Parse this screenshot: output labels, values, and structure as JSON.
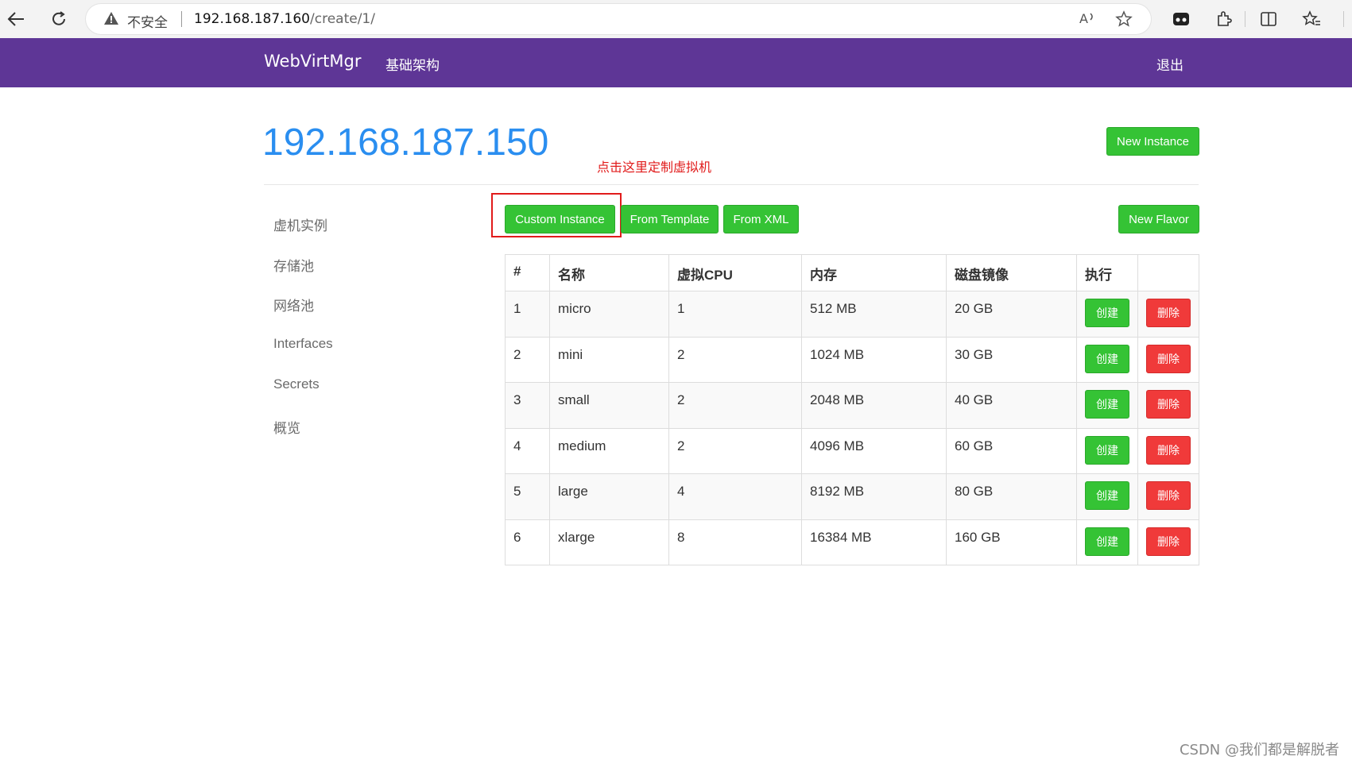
{
  "browser": {
    "security_label": "不安全",
    "url_host": "192.168.187.160",
    "url_path": "/create/1/"
  },
  "navbar": {
    "brand": "WebVirtMgr",
    "infrastructure_link": "基础架构",
    "logout_link": "退出"
  },
  "header": {
    "host_title": "192.168.187.150",
    "new_instance_button": "New Instance"
  },
  "annotation": {
    "text": "点击这里定制虚拟机"
  },
  "toolbar": {
    "custom_instance": "Custom Instance",
    "from_template": "From Template",
    "from_xml": "From XML",
    "new_flavor": "New Flavor"
  },
  "sidebar": {
    "items": [
      {
        "label": "虚机实例"
      },
      {
        "label": "存储池"
      },
      {
        "label": "网络池"
      },
      {
        "label": "Interfaces"
      },
      {
        "label": "Secrets"
      },
      {
        "label": "概览"
      }
    ]
  },
  "table": {
    "headers": [
      "#",
      "名称",
      "虚拟CPU",
      "内存",
      "磁盘镜像",
      "执行"
    ],
    "rows": [
      {
        "id": "1",
        "name": "micro",
        "vcpu": "1",
        "memory": "512 MB",
        "disk": "20 GB"
      },
      {
        "id": "2",
        "name": "mini",
        "vcpu": "2",
        "memory": "1024 MB",
        "disk": "30 GB"
      },
      {
        "id": "3",
        "name": "small",
        "vcpu": "2",
        "memory": "2048 MB",
        "disk": "40 GB"
      },
      {
        "id": "4",
        "name": "medium",
        "vcpu": "2",
        "memory": "4096 MB",
        "disk": "60 GB"
      },
      {
        "id": "5",
        "name": "large",
        "vcpu": "4",
        "memory": "8192 MB",
        "disk": "80 GB"
      },
      {
        "id": "6",
        "name": "xlarge",
        "vcpu": "8",
        "memory": "16384 MB",
        "disk": "160 GB"
      }
    ],
    "create_label": "创建",
    "delete_label": "删除"
  },
  "watermark": "CSDN @我们都是解脱者",
  "colors": {
    "navbar": "#5e3696",
    "title": "#2a8ef0",
    "success": "#35c335",
    "danger": "#f03a3a",
    "annotation": "#e11b1b"
  }
}
